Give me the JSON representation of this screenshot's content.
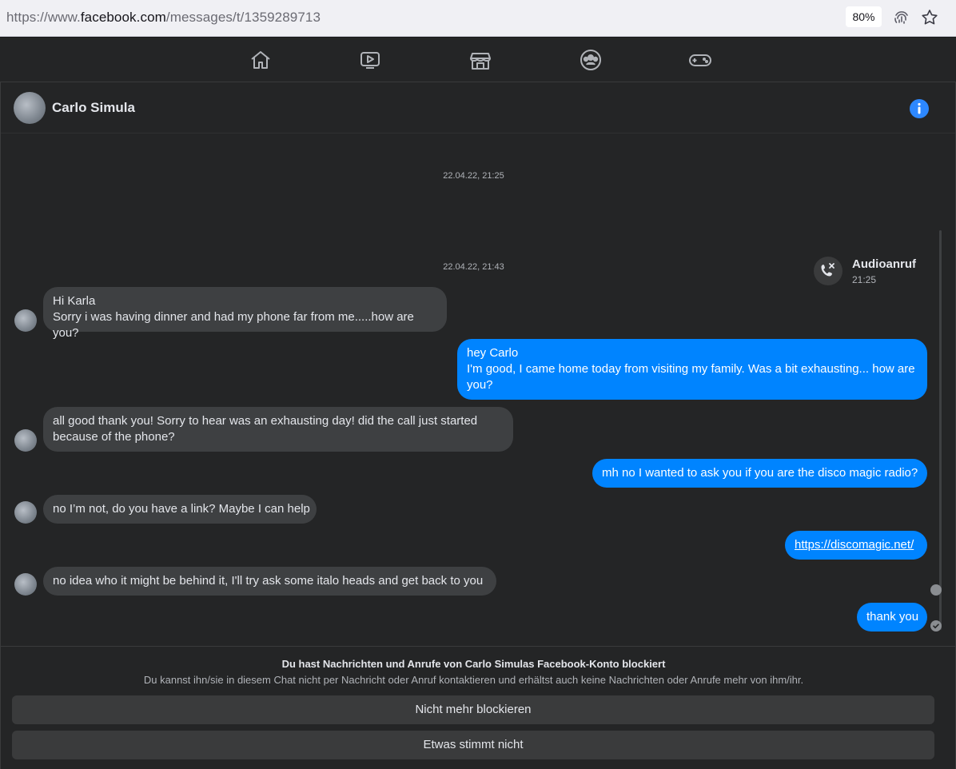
{
  "browser": {
    "url_prefix": "https://www.",
    "url_domain": "facebook.com",
    "url_path": "/messages/t/1359289713",
    "zoom": "80%"
  },
  "nav": {
    "icons": [
      "home-icon",
      "watch-icon",
      "marketplace-icon",
      "groups-icon",
      "gaming-icon"
    ]
  },
  "chat": {
    "contact_name": "Carlo Simula",
    "timestamps": [
      "22.04.22, 21:25",
      "22.04.22, 21:43"
    ],
    "call": {
      "title": "Audioanruf",
      "time": "21:25"
    },
    "messages": [
      {
        "side": "in",
        "lines": [
          "Hi Karla",
          "Sorry i was having dinner and had my phone far from me.....how are you?"
        ]
      },
      {
        "side": "out",
        "lines": [
          "hey Carlo",
          "I'm good, I came home today from visiting my family. Was a bit exhausting... how are you?"
        ]
      },
      {
        "side": "in",
        "text": "all good thank you! Sorry to hear was an exhausting day!  did the call just started because of the phone?"
      },
      {
        "side": "out",
        "text": "mh no I wanted to ask you if you are the disco magic radio?"
      },
      {
        "side": "in",
        "text": "no I’m not, do you have a link? Maybe I can help"
      },
      {
        "side": "out",
        "text": "https://discomagic.net/"
      },
      {
        "side": "in",
        "text": "no idea who it might be behind it, I'll try ask some italo heads and get back to you"
      },
      {
        "side": "out",
        "text": "thank you"
      }
    ]
  },
  "blocked": {
    "title": "Du hast Nachrichten und Anrufe von Carlo Simulas Facebook-Konto blockiert",
    "description": "Du kannst ihn/sie in diesem Chat nicht per Nachricht oder Anruf kontaktieren und erhältst auch keine Nachrichten oder Anrufe mehr von ihm/ihr.",
    "unblock_label": "Nicht mehr blockieren",
    "report_label": "Etwas stimmt nicht"
  },
  "colors": {
    "accent": "#0084ff",
    "background": "#242526",
    "incoming_bubble": "#3e4042"
  }
}
